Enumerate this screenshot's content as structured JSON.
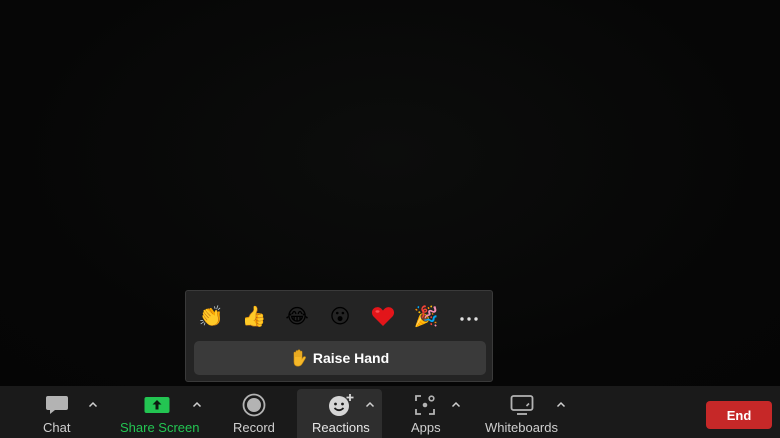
{
  "reactions_popup": {
    "emojis": [
      {
        "name": "clapping-hands",
        "glyph": "👏"
      },
      {
        "name": "thumbs-up",
        "glyph": "👍"
      },
      {
        "name": "tears-of-joy",
        "glyph": "😂"
      },
      {
        "name": "open-mouth",
        "glyph": "😮"
      },
      {
        "name": "red-heart",
        "glyph": "❤"
      },
      {
        "name": "party-popper",
        "glyph": "🎉"
      }
    ],
    "more_icon": "more-horizontal-icon",
    "raise_hand_label": "Raise Hand",
    "raise_hand_icon": "raised-hand-icon"
  },
  "toolbar": {
    "chat_label": "Chat",
    "share_screen_label": "Share Screen",
    "record_label": "Record",
    "reactions_label": "Reactions",
    "apps_label": "Apps",
    "whiteboards_label": "Whiteboards",
    "end_label": "End"
  },
  "colors": {
    "share_screen_accent": "#23c552",
    "end_button": "#c62828",
    "toolbar_bg": "#1a1a1a",
    "popup_bg": "#242424"
  }
}
